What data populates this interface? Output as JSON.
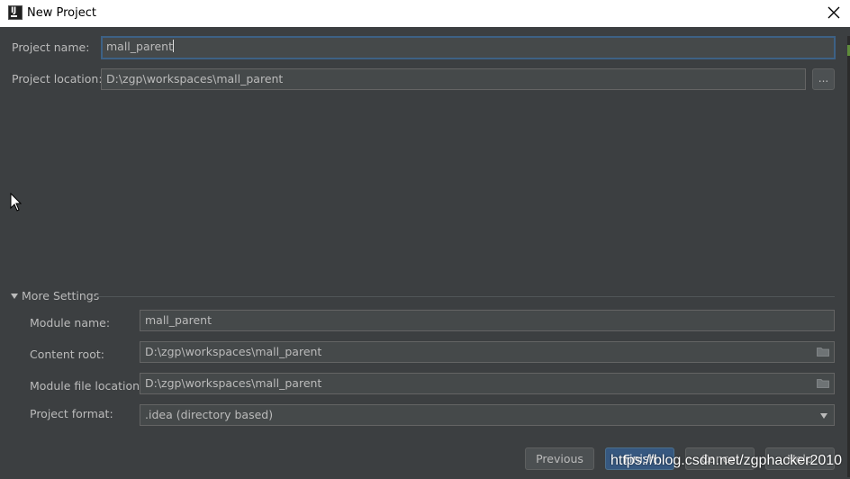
{
  "window": {
    "title": "New Project"
  },
  "project": {
    "name_label": "Project name:",
    "name_value": "mall_parent",
    "location_label": "Project location:",
    "location_value": "D:\\zgp\\workspaces\\mall_parent",
    "browse_label": "..."
  },
  "more_settings": {
    "header": "More Settings",
    "module_name_label": "Module name:",
    "module_name_value": "mall_parent",
    "content_root_label": "Content root:",
    "content_root_value": "D:\\zgp\\workspaces\\mall_parent",
    "module_file_location_label": "Module file location:",
    "module_file_location_value": "D:\\zgp\\workspaces\\mall_parent",
    "project_format_label": "Project format:",
    "project_format_value": ".idea (directory based)"
  },
  "buttons": {
    "previous": "Previous",
    "finish": "Finish",
    "cancel": "Cancel",
    "help": "Help"
  },
  "watermark": "https://blog.csdn.net/zgphacker2010",
  "colors": {
    "background": "#3c3f41",
    "field_background": "#45494a",
    "focus_border": "#3d6185",
    "default_button": "#365880",
    "text": "#bbbbbb"
  },
  "icons": {
    "app": "intellij-icon",
    "close": "close-icon",
    "folder": "folder-icon",
    "dropdown": "chevron-down-icon",
    "collapse": "triangle-down-icon",
    "cursor": "mouse-pointer-icon"
  }
}
